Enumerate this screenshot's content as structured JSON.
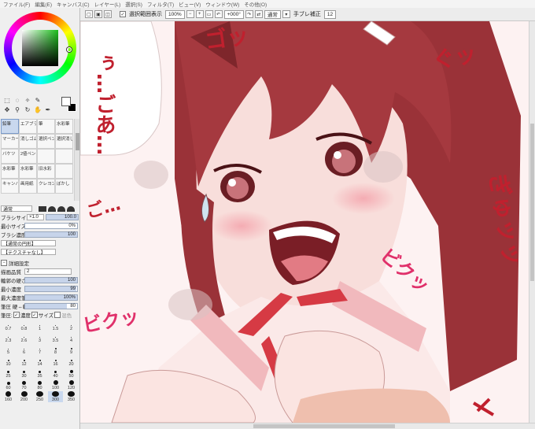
{
  "menu": [
    "ファイル(F)",
    "編集(E)",
    "キャンバス(C)",
    "レイヤー(L)",
    "選択(S)",
    "フィルタ(T)",
    "ビュー(V)",
    "ウィンドウ(W)",
    "その他(O)"
  ],
  "toolbar": {
    "selection_source_label": "選択範囲表示",
    "zoom": "100%",
    "rotation": "+000°",
    "blend_mode": "通常",
    "stabilizer_label": "手ブレ補正",
    "stabilizer_value": "12"
  },
  "brushes": [
    "鉛筆",
    "エアブラシ",
    "筆",
    "水彩筆",
    "マーカー",
    "消しゴム",
    "選択ペン",
    "選択消し",
    "バケツ",
    "2値ペン",
    "",
    "",
    "水彩筆",
    "水彩筆",
    "旧水彩",
    "",
    "キャンバス",
    "画用紙",
    "クレヨン",
    "ぼかし"
  ],
  "brush_props": {
    "mode": "通常",
    "size_label": "ブラシサイズ",
    "size_mult": "×1.0",
    "size_value": "100.0",
    "min_size_label": "最小サイズ",
    "min_size_value": "0%",
    "density_label": "ブラシ濃度",
    "density_value": "100",
    "density_fraction": 1.0,
    "shape_label": "【通常の円形】",
    "texture_label": "【テクスチャなし】",
    "detail_label": "詳細設定",
    "quality_label": "描画品質",
    "quality_value": "2",
    "hardness_label": "輪郭の硬さ",
    "hardness_value": "100",
    "min_density_label": "最小濃度",
    "min_density_value": "99",
    "max_pressure_label": "最大濃度筆圧",
    "max_pressure_value": "100%",
    "pressure_hardness_label": "筆圧 硬⇔軟",
    "pressure_hardness_value": "80",
    "pressure_label": "筆圧:",
    "pressure_density": "濃度",
    "pressure_size": "サイズ",
    "pressure_blend": "混色"
  },
  "brush_sizes": [
    "0.7",
    "0.8",
    "1",
    "1.5",
    "2",
    "2.3",
    "2.6",
    "3",
    "3.5",
    "4",
    "5",
    "6",
    "7",
    "8",
    "9",
    "10",
    "12",
    "14",
    "16",
    "20",
    "25",
    "30",
    "35",
    "40",
    "50",
    "60",
    "70",
    "80",
    "100",
    "120",
    "160",
    "200",
    "250",
    "300",
    "350"
  ],
  "selected_size": "300",
  "canvas_text": {
    "sfx_top": "ゴッ",
    "sfx_right": "ぐッ",
    "sfx_right_long": "ぎゅッッ",
    "sfx_mid": "ビクッ",
    "sfx_left": "ビクッ",
    "dialog_left": "ぅ…ごあ…",
    "sfx_left_dash": "ご…"
  },
  "colors": {
    "accent": "#b03a4a",
    "hair": "#8a2a30",
    "skin": "#f6dcd8",
    "ribbon": "#d63a44",
    "sfx": "#e0306a"
  }
}
